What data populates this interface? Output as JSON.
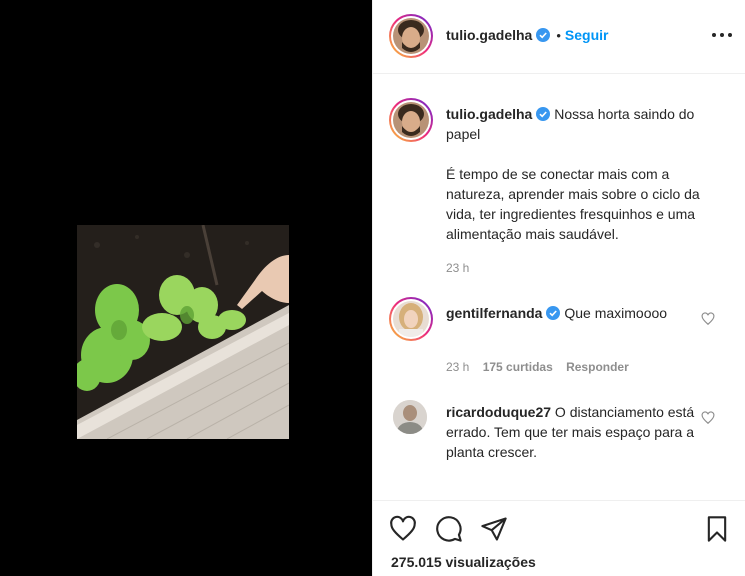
{
  "post": {
    "author": "tulio.gadelha",
    "follow_label": "Seguir",
    "dot": "•"
  },
  "caption": {
    "author": "tulio.gadelha",
    "line1": "Nossa horta saindo do papel",
    "line2": "É tempo de se conectar mais com a natureza, aprender mais sobre o ciclo da vida, ter ingredientes fresquinhos e uma alimentação mais saudável.",
    "time": "23 h"
  },
  "comments": [
    {
      "author": "gentilfernanda",
      "verified": true,
      "text": "Que maximoooo",
      "time": "23 h",
      "likes": "175 curtidas",
      "reply": "Responder"
    },
    {
      "author": "ricardoduque27",
      "verified": false,
      "text": "O distanciamento está errado. Tem que ter mais espaço para a planta crescer."
    }
  ],
  "stats": {
    "views": "275.015 visualizações"
  },
  "colors": {
    "accent": "#0095f6",
    "verified": "#3897f0",
    "muted": "#8e8e8e",
    "text": "#262626"
  },
  "icons": {
    "like": "heart-icon",
    "comment": "comment-icon",
    "share": "paper-plane-icon",
    "save": "bookmark-icon",
    "more": "more-options-icon",
    "verified": "verified-badge-icon"
  }
}
